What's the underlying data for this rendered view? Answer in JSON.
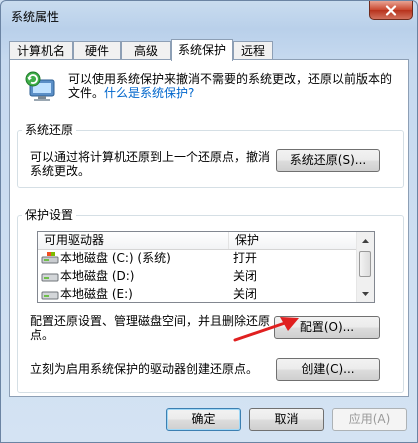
{
  "window": {
    "title": "系统属性",
    "ghost_title": "",
    "close_label": "✕"
  },
  "tabs": [
    {
      "label": "计算机名",
      "active": false
    },
    {
      "label": "硬件",
      "active": false
    },
    {
      "label": "高级",
      "active": false
    },
    {
      "label": "系统保护",
      "active": true
    },
    {
      "label": "远程",
      "active": false
    }
  ],
  "intro": {
    "text": "可以使用系统保护来撤消不需要的系统更改，还原以前版本的文件。",
    "link": "什么是系统保护?"
  },
  "restore_group": {
    "label": "系统还原",
    "description": "可以通过将计算机还原到上一个还原点，撤消系统更改。",
    "button": "系统还原(S)..."
  },
  "protection_group": {
    "label": "保护设置",
    "columns": [
      "可用驱动器",
      "保护"
    ],
    "drives": [
      {
        "name": "本地磁盘 (C:) (系统)",
        "protection": "打开",
        "icon": "system-drive-icon"
      },
      {
        "name": "本地磁盘 (D:)",
        "protection": "关闭",
        "icon": "drive-icon"
      },
      {
        "name": "本地磁盘 (E:)",
        "protection": "关闭",
        "icon": "drive-icon"
      }
    ],
    "configure_text": "配置还原设置、管理磁盘空间，并且删除还原点。",
    "configure_button": "配置(O)...",
    "create_text": "立刻为启用系统保护的驱动器创建还原点。",
    "create_button": "创建(C)..."
  },
  "footer": {
    "ok": "确定",
    "cancel": "取消",
    "apply": "应用(A)"
  },
  "colors": {
    "accent_link": "#0066cc",
    "annotation_arrow": "#e02020",
    "close_button": "#c9472e"
  }
}
